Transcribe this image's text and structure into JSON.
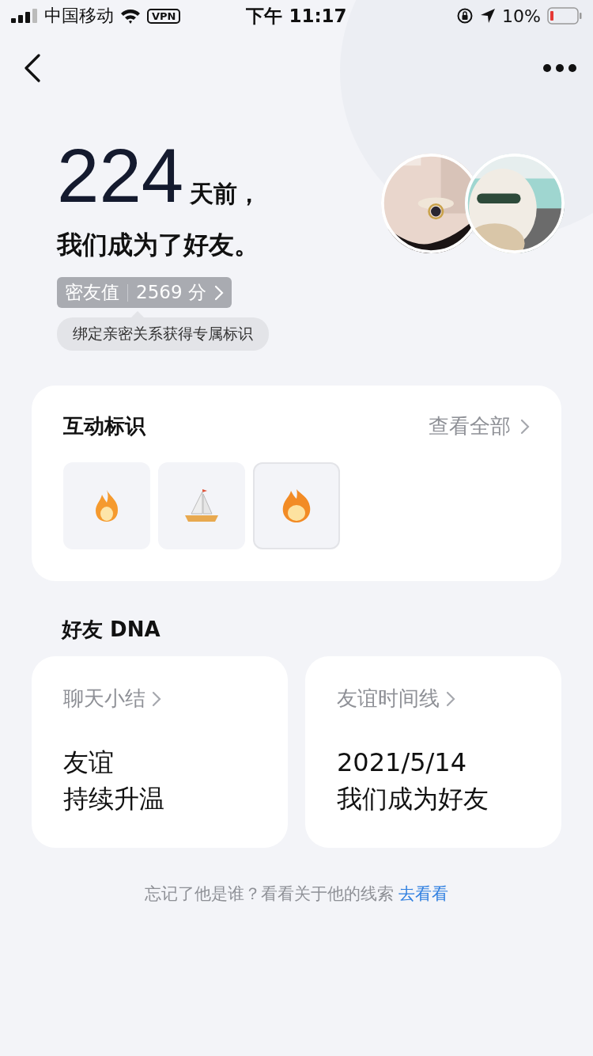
{
  "status_bar": {
    "carrier": "中国移动",
    "vpn": "VPN",
    "time": "下午 11:17",
    "battery": "10%"
  },
  "hero": {
    "days": "224",
    "days_suffix": "天前，",
    "subtitle": "我们成为了好友。",
    "score_label": "密友值",
    "score_value": "2569 分",
    "tip": "绑定亲密关系获得专属标识"
  },
  "badges_card": {
    "title": "互动标识",
    "link": "查看全部",
    "badges": [
      {
        "kind": "flame",
        "selected": false
      },
      {
        "kind": "sailboat",
        "selected": false
      },
      {
        "kind": "flame-large",
        "selected": true
      }
    ]
  },
  "dna": {
    "title": "好友 DNA",
    "cards": [
      {
        "title": "聊天小结",
        "lines": [
          "友谊",
          "持续升温"
        ]
      },
      {
        "title": "友谊时间线",
        "lines": [
          "2021/5/14",
          "我们成为好友"
        ]
      }
    ]
  },
  "footer": {
    "text": "忘记了他是谁？看看关于他的线索",
    "link": "去看看"
  }
}
